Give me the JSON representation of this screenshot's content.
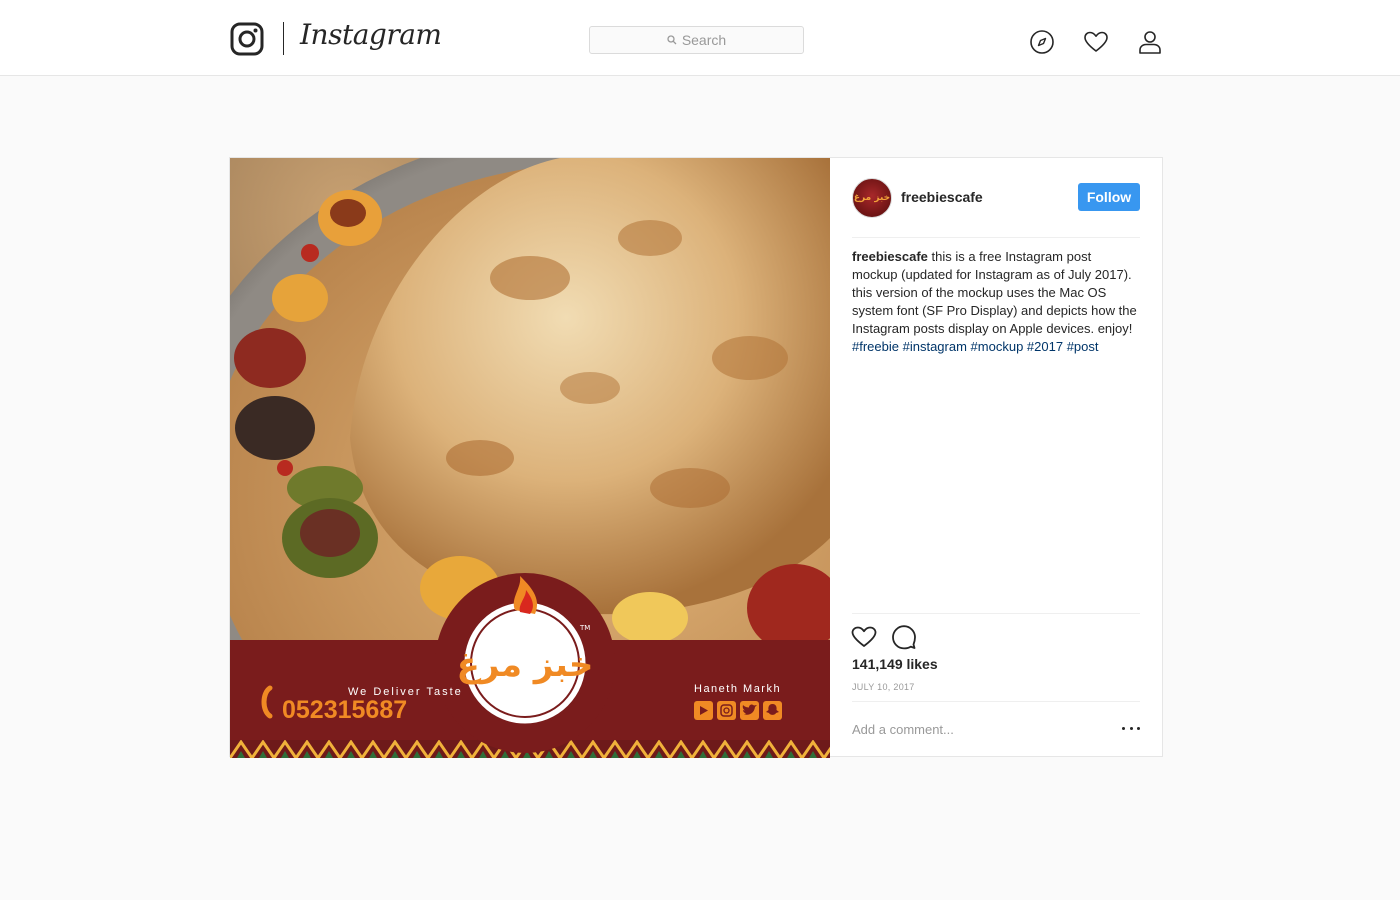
{
  "nav": {
    "wordmark": "Instagram",
    "search_placeholder": "Search"
  },
  "post": {
    "username": "freebiescafe",
    "avatar_text": "خبز مرغ",
    "follow_label": "Follow",
    "caption": {
      "username": "freebiescafe",
      "text": " this is a free Instagram post mockup (updated for Instagram as of July 2017). this version of the mockup uses the Mac OS system font (SF Pro Display) and depicts how the Instagram posts display on Apple devices. enjoy! ",
      "hashtags": [
        "#freebie",
        "#instagram",
        "#mockup",
        "#2017",
        "#post"
      ]
    },
    "likes": "141,149 likes",
    "date": "JULY 10, 2017",
    "comment_placeholder": "Add a comment..."
  },
  "photo": {
    "tagline": "We Deliver Taste",
    "phone": "052315687",
    "handle": "Haneth Markh",
    "brand": "خبز مرغ",
    "trademark": "TM"
  },
  "colors": {
    "follow_button": "#3897f0",
    "hashtag": "#003569",
    "banner": "#7a1c1c",
    "accent_orange": "#f08a24"
  }
}
